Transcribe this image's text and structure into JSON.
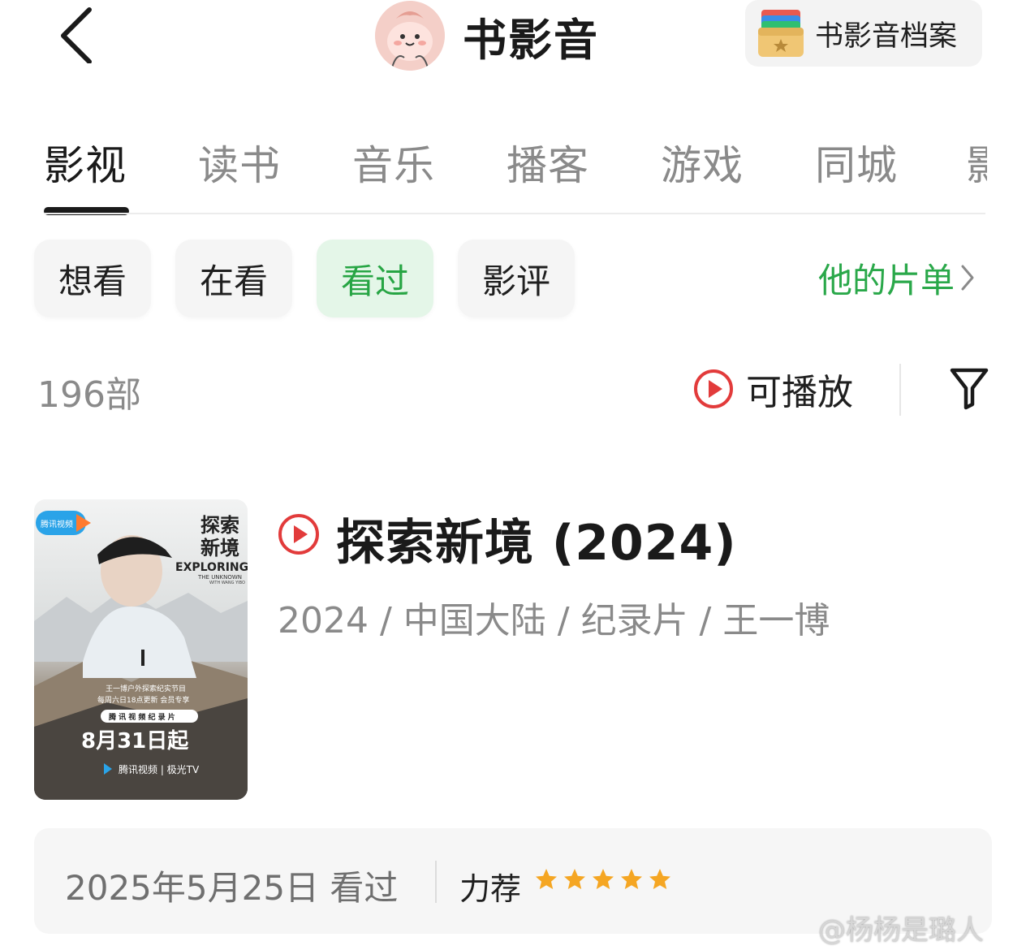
{
  "header": {
    "title": "书影音",
    "archive_label": "书影音档案"
  },
  "tabs": [
    {
      "label": "影视",
      "active": true
    },
    {
      "label": "读书",
      "active": false
    },
    {
      "label": "音乐",
      "active": false
    },
    {
      "label": "播客",
      "active": false
    },
    {
      "label": "游戏",
      "active": false
    },
    {
      "label": "同城",
      "active": false
    },
    {
      "label": "影",
      "active": false
    }
  ],
  "filters": [
    {
      "label": "想看",
      "active": false
    },
    {
      "label": "在看",
      "active": false
    },
    {
      "label": "看过",
      "active": true
    },
    {
      "label": "影评",
      "active": false
    }
  ],
  "list_link": "他的片单",
  "count": "196部",
  "playable_label": "可播放",
  "colors": {
    "accent_green": "#2aa84a",
    "play_red": "#e23b3b",
    "star_orange": "#f5a623"
  },
  "movie": {
    "title": "探索新境 (2024)",
    "meta": "2024 / 中国大陆 / 纪录片 / 王一博",
    "poster": {
      "platform_badge": "腾讯视频",
      "title_cn_line1": "探索",
      "title_cn_line2": "新境",
      "title_en": "EXPLORING",
      "title_en_sub": "THE UNKNOWN",
      "title_en_with": "WITH WANG YIBO",
      "desc_line1": "王一博户外探索纪实节目",
      "desc_line2": "每周六日18点更新 会员专享",
      "tag": "腾 讯 视 频 纪 录 片",
      "date": "8月31日起",
      "platforms": "腾讯视频 | 极光TV"
    },
    "watched_date": "2025年5月25日 看过",
    "rating_label": "力荐",
    "rating_stars": 5
  },
  "watermark": "@杨杨是璐人"
}
